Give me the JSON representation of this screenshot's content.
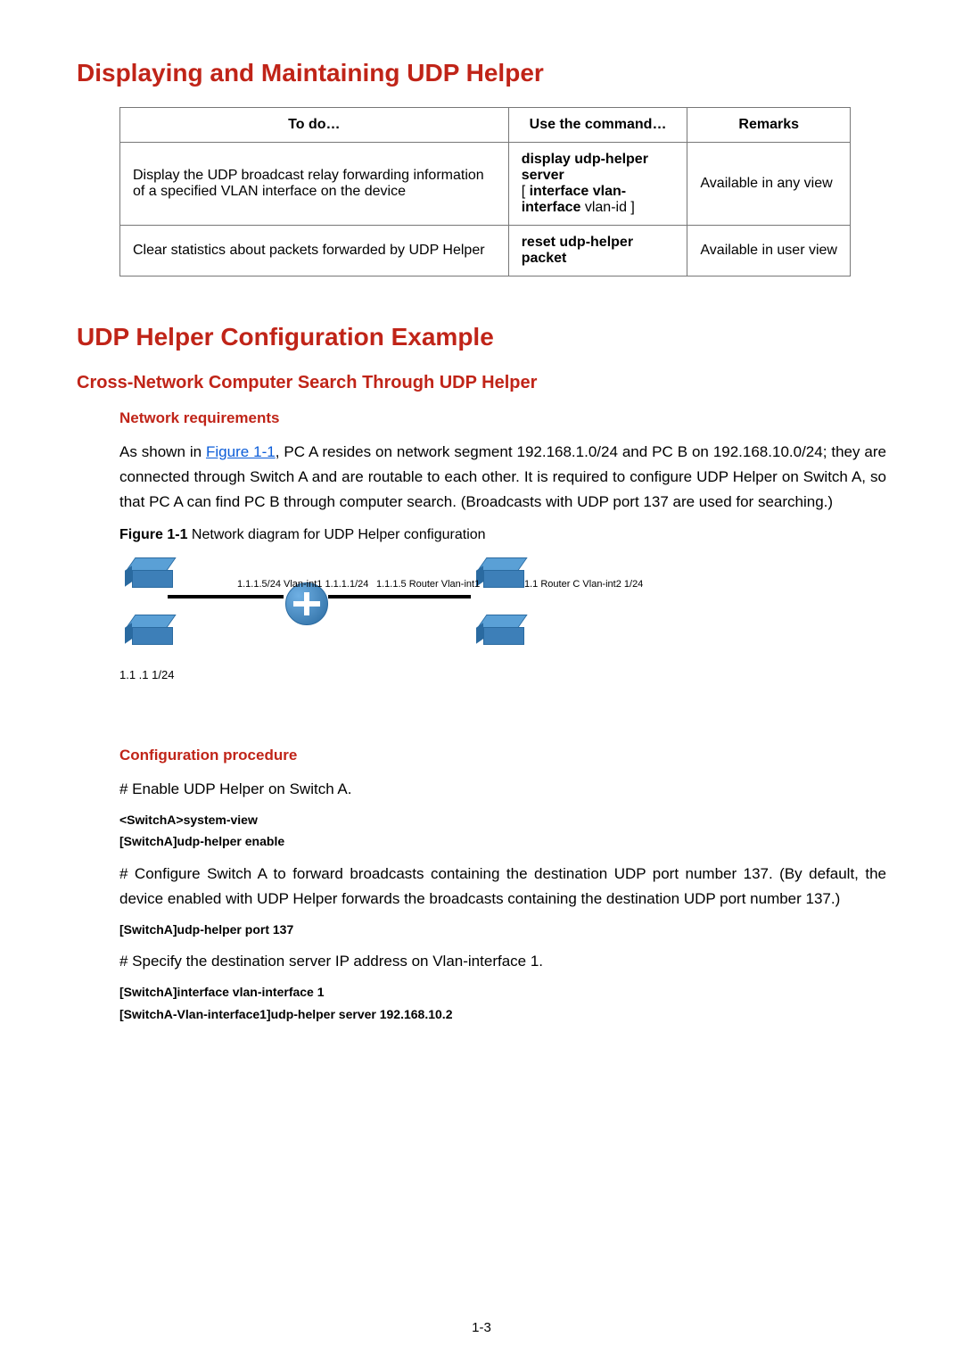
{
  "heading1": "Displaying and Maintaining UDP Helper",
  "table": {
    "headers": {
      "c1": "To do…",
      "c2": "Use the command…",
      "c3": "Remarks"
    },
    "rows": [
      {
        "todo": "Display the UDP broadcast relay forwarding information of a specified VLAN interface on the device",
        "cmd_bold1": "display udp-helper server",
        "cmd_plain_open": "[ ",
        "cmd_bold2": "interface vlan-interface",
        "cmd_plain_rest": " vlan-id ]",
        "remarks": "Available in any view"
      },
      {
        "todo": "Clear statistics about packets forwarded by UDP Helper",
        "cmd_bold1": "reset udp-helper packet",
        "cmd_plain_open": "",
        "cmd_bold2": "",
        "cmd_plain_rest": "",
        "remarks": "Available in user view"
      }
    ]
  },
  "heading2": "UDP Helper Configuration Example",
  "sub1": "Cross-Network Computer Search Through UDP Helper",
  "netreq_h": "Network requirements",
  "netreq_p_pre": "As shown in ",
  "netreq_link": "Figure 1-1",
  "netreq_p_post": ", PC A resides on network segment 192.168.1.0/24 and PC B on 192.168.10.0/24; they are connected through Switch A and are routable to each other. It is required to configure UDP Helper on Switch A, so that PC A can find PC B through computer search. (Broadcasts with UDP port 137 are used for searching.)",
  "fig_caption_b": "Figure 1-1",
  "fig_caption_rest": " Network diagram for UDP Helper configuration",
  "diagram": {
    "left_label_top": "1.1.1.5/24 Vlan-int1 1.1.1.1/24",
    "mid_label_top": "1.1.1.5 Router Vlan-int1",
    "right_label_top": "1.1 Router C Vlan-int2 1/24",
    "left_pc_label": "1.1      .1  1/24"
  },
  "conf_h": "Configuration procedure",
  "conf_steps": {
    "p1": "# Enable UDP Helper on Switch A.",
    "c1": "<SwitchA>system-view",
    "c2": "[SwitchA]udp-helper enable",
    "p2": "# Configure Switch A to forward broadcasts containing the destination UDP port number 137. (By default, the device enabled with UDP Helper forwards the broadcasts containing the destination UDP port number 137.)",
    "c3": "[SwitchA]udp-helper port 137",
    "p3": "# Specify the destination server IP address on Vlan-interface 1.",
    "c4": "[SwitchA]interface vlan-interface 1",
    "c5": "[SwitchA-Vlan-interface1]udp-helper server 192.168.10.2"
  },
  "page_number": "1-3"
}
